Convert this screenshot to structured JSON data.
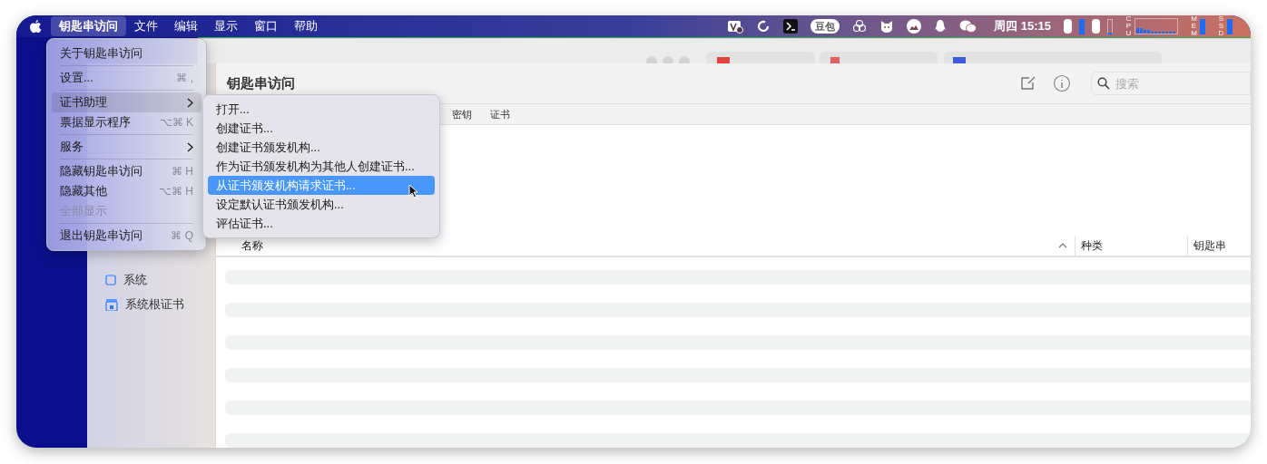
{
  "menu_bar": {
    "items": [
      {
        "label": "钥匙串访问",
        "selected": true
      },
      {
        "label": "文件",
        "selected": false
      },
      {
        "label": "编辑",
        "selected": false
      },
      {
        "label": "显示",
        "selected": false
      },
      {
        "label": "窗口",
        "selected": false
      },
      {
        "label": "帮助",
        "selected": false
      }
    ],
    "badge": "豆包",
    "clock": "周四 15:15",
    "meters": [
      {
        "label": "CPU",
        "kind": "graph"
      },
      {
        "label": "MEM",
        "kind": "bar"
      },
      {
        "label": "SSD",
        "kind": "bar"
      }
    ]
  },
  "app_menu": [
    {
      "kind": "item",
      "label": "关于钥匙串访问",
      "selected": false,
      "disabled": false
    },
    {
      "kind": "separator"
    },
    {
      "kind": "item",
      "label": "设置...",
      "shortcut": "⌘ ,",
      "selected": false,
      "disabled": false
    },
    {
      "kind": "separator"
    },
    {
      "kind": "submenu",
      "label": "证书助理",
      "selected": true,
      "disabled": false
    },
    {
      "kind": "item",
      "label": "票据显示程序",
      "shortcut": "⌥⌘ K",
      "selected": false,
      "disabled": false
    },
    {
      "kind": "separator"
    },
    {
      "kind": "submenu",
      "label": "服务",
      "selected": false,
      "disabled": false
    },
    {
      "kind": "separator"
    },
    {
      "kind": "item",
      "label": "隐藏钥匙串访问",
      "shortcut": "⌘ H",
      "selected": false,
      "disabled": false
    },
    {
      "kind": "item",
      "label": "隐藏其他",
      "shortcut": "⌥⌘ H",
      "selected": false,
      "disabled": false
    },
    {
      "kind": "item",
      "label": "全部显示",
      "selected": false,
      "disabled": true
    },
    {
      "kind": "separator"
    },
    {
      "kind": "item",
      "label": "退出钥匙串访问",
      "shortcut": "⌘ Q",
      "selected": false,
      "disabled": false
    }
  ],
  "submenu": [
    {
      "label": "打开...",
      "selected": false
    },
    {
      "label": "创建证书...",
      "selected": false
    },
    {
      "label": "创建证书颁发机构...",
      "selected": false
    },
    {
      "label": "作为证书颁发机构为其他人创建证书...",
      "selected": false
    },
    {
      "label": "从证书颁发机构请求证书...",
      "selected": true
    },
    {
      "label": "设定默认证书颁发机构...",
      "selected": false
    },
    {
      "label": "评估证书...",
      "selected": false
    }
  ],
  "window": {
    "title": "钥匙串访问",
    "search": {
      "placeholder": "搜索"
    },
    "tabs": [
      {
        "label": "密钥",
        "selected": false
      },
      {
        "label": "证书",
        "selected": false
      }
    ],
    "sidebar": {
      "items": [
        {
          "label": "系统",
          "kind": "box"
        },
        {
          "label": "系统根证书",
          "kind": "lock"
        }
      ]
    },
    "table": {
      "columns": [
        {
          "label": "名称",
          "sorted": true
        },
        {
          "label": "种类",
          "sorted": false
        },
        {
          "label": "钥匙串",
          "sorted": false
        }
      ]
    }
  }
}
